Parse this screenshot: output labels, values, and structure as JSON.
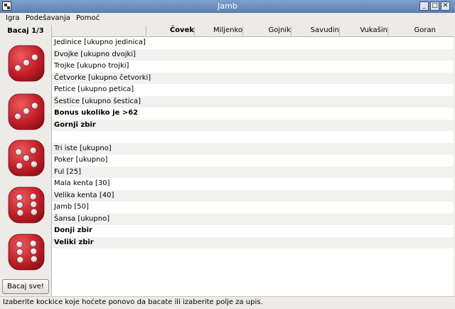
{
  "window": {
    "title": "Jamb"
  },
  "menu": {
    "items": [
      "Igra",
      "Podešavanja",
      "Pomoć"
    ]
  },
  "left": {
    "roll_label": "Bacaj 1/3",
    "dice": [
      3,
      3,
      5,
      6,
      6
    ],
    "roll_all_button": "Bacaj sve!"
  },
  "table": {
    "columns": [
      "Čovek",
      "Miljenko",
      "Gojnik",
      "Savudin",
      "Vukašin",
      "Goran"
    ],
    "rows": [
      {
        "label": "Jedinice [ukupno jedinica]",
        "bold": false
      },
      {
        "label": "Dvojke [ukupno dvojki]",
        "bold": false
      },
      {
        "label": "Trojke [ukupno trojki]",
        "bold": false
      },
      {
        "label": "Četvorke [ukupno četvorki]",
        "bold": false
      },
      {
        "label": "Petice [ukupno petica]",
        "bold": false
      },
      {
        "label": "Šestice [ukupno šestica]",
        "bold": false
      },
      {
        "label": "Bonus ukoliko je >62",
        "bold": true
      },
      {
        "label": "Gornji zbir",
        "bold": true
      },
      {
        "label": "",
        "bold": false
      },
      {
        "label": "Tri iste [ukupno]",
        "bold": false
      },
      {
        "label": "Poker [ukupno]",
        "bold": false
      },
      {
        "label": "Ful [25]",
        "bold": false
      },
      {
        "label": "Mala kenta [30]",
        "bold": false
      },
      {
        "label": "Velika kenta [40]",
        "bold": false
      },
      {
        "label": "Jamb [50]",
        "bold": false
      },
      {
        "label": "Šansa [ukupno]",
        "bold": false
      },
      {
        "label": "Donji zbir",
        "bold": true
      },
      {
        "label": "Veliki zbir",
        "bold": true
      }
    ]
  },
  "status": {
    "text": "Izaberite kockice koje hoćete ponovo da bacate ili izaberite polje za upis."
  },
  "colors": {
    "titlebar": "#6f91c1",
    "die": "#c8202a",
    "pip": "#e8e8e8",
    "alt_row": "#f1f1f0"
  }
}
